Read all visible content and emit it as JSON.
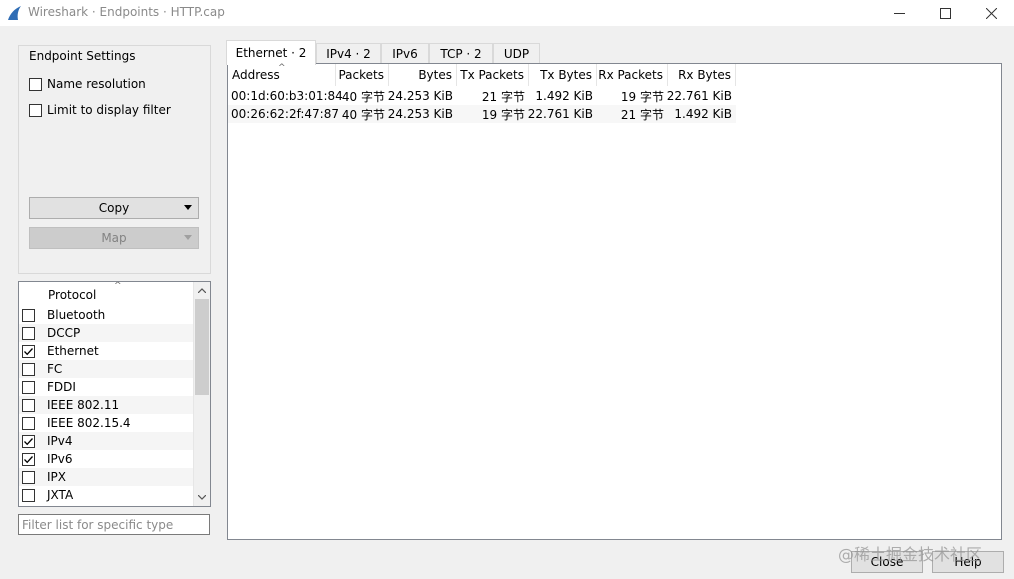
{
  "window": {
    "title": "Wireshark · Endpoints · HTTP.cap",
    "controls": {
      "minimize": "minimize-icon",
      "maximize": "maximize-icon",
      "close": "close-icon"
    }
  },
  "settings": {
    "group_title": "Endpoint Settings",
    "name_resolution": {
      "label": "Name resolution",
      "checked": false
    },
    "limit_display_filter": {
      "label": "Limit to display filter",
      "checked": false
    },
    "copy_label": "Copy",
    "map_label": "Map"
  },
  "protocols": {
    "header": "Protocol",
    "items": [
      {
        "name": "Bluetooth",
        "checked": false
      },
      {
        "name": "DCCP",
        "checked": false
      },
      {
        "name": "Ethernet",
        "checked": true
      },
      {
        "name": "FC",
        "checked": false
      },
      {
        "name": "FDDI",
        "checked": false
      },
      {
        "name": "IEEE 802.11",
        "checked": false
      },
      {
        "name": "IEEE 802.15.4",
        "checked": false
      },
      {
        "name": "IPv4",
        "checked": true
      },
      {
        "name": "IPv6",
        "checked": true
      },
      {
        "name": "IPX",
        "checked": false
      },
      {
        "name": "JXTA",
        "checked": false
      }
    ]
  },
  "filter": {
    "placeholder": "Filter list for specific type",
    "value": ""
  },
  "tabs": [
    {
      "label": "Ethernet · 2",
      "active": true
    },
    {
      "label": "IPv4 · 2",
      "active": false
    },
    {
      "label": "IPv6",
      "active": false
    },
    {
      "label": "TCP · 2",
      "active": false
    },
    {
      "label": "UDP",
      "active": false
    }
  ],
  "table": {
    "columns": [
      "Address",
      "Packets",
      "Bytes",
      "Tx Packets",
      "Tx Bytes",
      "Rx Packets",
      "Rx Bytes"
    ],
    "rows": [
      [
        "00:1d:60:b3:01:84",
        "40 字节",
        "24.253 KiB",
        "21 字节",
        "1.492 KiB",
        "19 字节",
        "22.761 KiB"
      ],
      [
        "00:26:62:2f:47:87",
        "40 字节",
        "24.253 KiB",
        "19 字节",
        "22.761 KiB",
        "21 字节",
        "1.492 KiB"
      ]
    ]
  },
  "buttons": {
    "close": "Close",
    "help": "Help"
  },
  "watermark": "@稀土掘金技术社区",
  "colors": {
    "window_bg": "#f0f0f0",
    "app_icon": "#2f6db5"
  }
}
